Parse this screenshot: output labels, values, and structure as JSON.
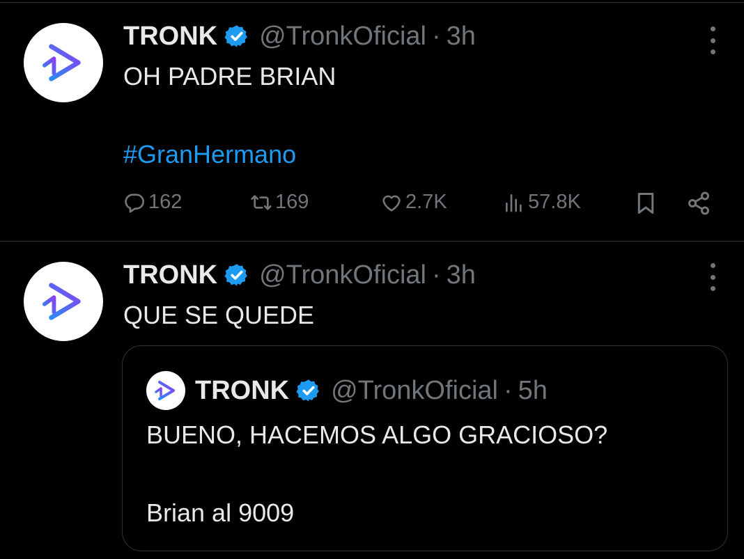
{
  "colors": {
    "background": "#000000",
    "primary_text": "#e7e9ea",
    "secondary_text": "#71767b",
    "link": "#1d9bf0",
    "verified_badge": "#1d9bf0",
    "divider": "#2f3336",
    "logo_gradient_start": "#2a8cf5",
    "logo_gradient_end": "#8b3ff0"
  },
  "tweets": [
    {
      "author": {
        "display_name": "TRONK",
        "handle": "@TronkOficial",
        "verified": true,
        "avatar_icon": "tronk-logo-icon"
      },
      "separator": "·",
      "time": "3h",
      "text_line_1": "OH PADRE BRIAN",
      "hashtag": "#GranHermano",
      "actions": {
        "replies": "162",
        "reposts": "169",
        "likes": "2.7K",
        "views": "57.8K"
      },
      "icons": {
        "reply": "reply-icon",
        "repost": "repost-icon",
        "like": "heart-icon",
        "views": "views-chart-icon",
        "bookmark": "bookmark-icon",
        "share": "share-icon",
        "more": "more-options-icon"
      }
    },
    {
      "author": {
        "display_name": "TRONK",
        "handle": "@TronkOficial",
        "verified": true,
        "avatar_icon": "tronk-logo-icon"
      },
      "separator": "·",
      "time": "3h",
      "text": "QUE SE QUEDE",
      "quoted_tweet": {
        "author": {
          "display_name": "TRONK",
          "handle": "@TronkOficial",
          "verified": true
        },
        "separator": "·",
        "time": "5h",
        "text_line_1": "BUENO, HACEMOS ALGO GRACIOSO?",
        "text_line_2": "Brian al 9009"
      }
    }
  ]
}
